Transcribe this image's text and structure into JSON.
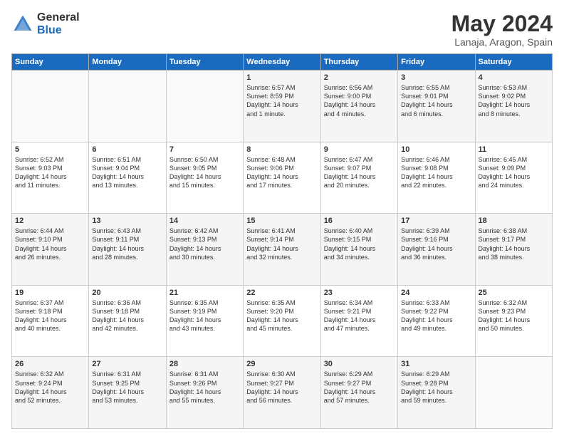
{
  "logo": {
    "general": "General",
    "blue": "Blue"
  },
  "title": "May 2024",
  "location": "Lanaja, Aragon, Spain",
  "days_of_week": [
    "Sunday",
    "Monday",
    "Tuesday",
    "Wednesday",
    "Thursday",
    "Friday",
    "Saturday"
  ],
  "weeks": [
    [
      {
        "day": "",
        "content": ""
      },
      {
        "day": "",
        "content": ""
      },
      {
        "day": "",
        "content": ""
      },
      {
        "day": "1",
        "content": "Sunrise: 6:57 AM\nSunset: 8:59 PM\nDaylight: 14 hours\nand 1 minute."
      },
      {
        "day": "2",
        "content": "Sunrise: 6:56 AM\nSunset: 9:00 PM\nDaylight: 14 hours\nand 4 minutes."
      },
      {
        "day": "3",
        "content": "Sunrise: 6:55 AM\nSunset: 9:01 PM\nDaylight: 14 hours\nand 6 minutes."
      },
      {
        "day": "4",
        "content": "Sunrise: 6:53 AM\nSunset: 9:02 PM\nDaylight: 14 hours\nand 8 minutes."
      }
    ],
    [
      {
        "day": "5",
        "content": "Sunrise: 6:52 AM\nSunset: 9:03 PM\nDaylight: 14 hours\nand 11 minutes."
      },
      {
        "day": "6",
        "content": "Sunrise: 6:51 AM\nSunset: 9:04 PM\nDaylight: 14 hours\nand 13 minutes."
      },
      {
        "day": "7",
        "content": "Sunrise: 6:50 AM\nSunset: 9:05 PM\nDaylight: 14 hours\nand 15 minutes."
      },
      {
        "day": "8",
        "content": "Sunrise: 6:48 AM\nSunset: 9:06 PM\nDaylight: 14 hours\nand 17 minutes."
      },
      {
        "day": "9",
        "content": "Sunrise: 6:47 AM\nSunset: 9:07 PM\nDaylight: 14 hours\nand 20 minutes."
      },
      {
        "day": "10",
        "content": "Sunrise: 6:46 AM\nSunset: 9:08 PM\nDaylight: 14 hours\nand 22 minutes."
      },
      {
        "day": "11",
        "content": "Sunrise: 6:45 AM\nSunset: 9:09 PM\nDaylight: 14 hours\nand 24 minutes."
      }
    ],
    [
      {
        "day": "12",
        "content": "Sunrise: 6:44 AM\nSunset: 9:10 PM\nDaylight: 14 hours\nand 26 minutes."
      },
      {
        "day": "13",
        "content": "Sunrise: 6:43 AM\nSunset: 9:11 PM\nDaylight: 14 hours\nand 28 minutes."
      },
      {
        "day": "14",
        "content": "Sunrise: 6:42 AM\nSunset: 9:13 PM\nDaylight: 14 hours\nand 30 minutes."
      },
      {
        "day": "15",
        "content": "Sunrise: 6:41 AM\nSunset: 9:14 PM\nDaylight: 14 hours\nand 32 minutes."
      },
      {
        "day": "16",
        "content": "Sunrise: 6:40 AM\nSunset: 9:15 PM\nDaylight: 14 hours\nand 34 minutes."
      },
      {
        "day": "17",
        "content": "Sunrise: 6:39 AM\nSunset: 9:16 PM\nDaylight: 14 hours\nand 36 minutes."
      },
      {
        "day": "18",
        "content": "Sunrise: 6:38 AM\nSunset: 9:17 PM\nDaylight: 14 hours\nand 38 minutes."
      }
    ],
    [
      {
        "day": "19",
        "content": "Sunrise: 6:37 AM\nSunset: 9:18 PM\nDaylight: 14 hours\nand 40 minutes."
      },
      {
        "day": "20",
        "content": "Sunrise: 6:36 AM\nSunset: 9:18 PM\nDaylight: 14 hours\nand 42 minutes."
      },
      {
        "day": "21",
        "content": "Sunrise: 6:35 AM\nSunset: 9:19 PM\nDaylight: 14 hours\nand 43 minutes."
      },
      {
        "day": "22",
        "content": "Sunrise: 6:35 AM\nSunset: 9:20 PM\nDaylight: 14 hours\nand 45 minutes."
      },
      {
        "day": "23",
        "content": "Sunrise: 6:34 AM\nSunset: 9:21 PM\nDaylight: 14 hours\nand 47 minutes."
      },
      {
        "day": "24",
        "content": "Sunrise: 6:33 AM\nSunset: 9:22 PM\nDaylight: 14 hours\nand 49 minutes."
      },
      {
        "day": "25",
        "content": "Sunrise: 6:32 AM\nSunset: 9:23 PM\nDaylight: 14 hours\nand 50 minutes."
      }
    ],
    [
      {
        "day": "26",
        "content": "Sunrise: 6:32 AM\nSunset: 9:24 PM\nDaylight: 14 hours\nand 52 minutes."
      },
      {
        "day": "27",
        "content": "Sunrise: 6:31 AM\nSunset: 9:25 PM\nDaylight: 14 hours\nand 53 minutes."
      },
      {
        "day": "28",
        "content": "Sunrise: 6:31 AM\nSunset: 9:26 PM\nDaylight: 14 hours\nand 55 minutes."
      },
      {
        "day": "29",
        "content": "Sunrise: 6:30 AM\nSunset: 9:27 PM\nDaylight: 14 hours\nand 56 minutes."
      },
      {
        "day": "30",
        "content": "Sunrise: 6:29 AM\nSunset: 9:27 PM\nDaylight: 14 hours\nand 57 minutes."
      },
      {
        "day": "31",
        "content": "Sunrise: 6:29 AM\nSunset: 9:28 PM\nDaylight: 14 hours\nand 59 minutes."
      },
      {
        "day": "",
        "content": ""
      }
    ]
  ]
}
